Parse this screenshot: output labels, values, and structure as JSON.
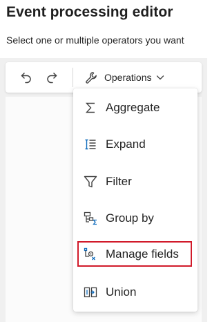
{
  "page": {
    "title": "Event processing editor",
    "subtitle": "Select one or multiple operators you want"
  },
  "toolbar": {
    "undo_icon": "undo-icon",
    "redo_icon": "redo-icon",
    "operations_label": "Operations",
    "operations_icon": "wrench-icon",
    "chevron_icon": "chevron-down-icon"
  },
  "menu": {
    "items": [
      {
        "label": "Aggregate",
        "icon": "sigma-icon"
      },
      {
        "label": "Expand",
        "icon": "expand-list-icon"
      },
      {
        "label": "Filter",
        "icon": "filter-funnel-icon"
      },
      {
        "label": "Group by",
        "icon": "group-by-icon"
      },
      {
        "label": "Manage fields",
        "icon": "manage-fields-icon",
        "highlighted": true
      },
      {
        "label": "Union",
        "icon": "union-icon"
      }
    ]
  },
  "colors": {
    "highlight_border": "#d11a2a",
    "icon_accent": "#0f6cbd",
    "canvas_bg": "#f0f0f0"
  }
}
